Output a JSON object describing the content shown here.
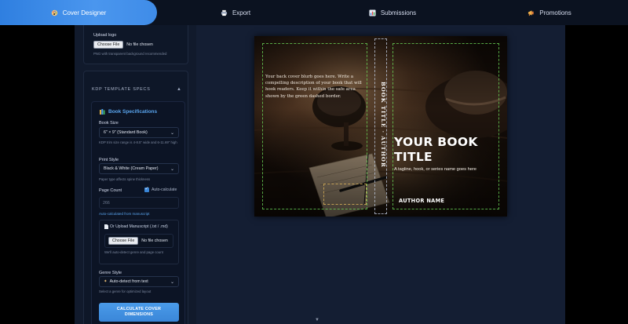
{
  "nav": {
    "tabs": [
      {
        "label": "Cover Designer",
        "icon": "palette-icon",
        "active": true
      },
      {
        "label": "Export",
        "icon": "printer-icon",
        "active": false
      },
      {
        "label": "Submissions",
        "icon": "chart-icon",
        "active": false
      },
      {
        "label": "Promotions",
        "icon": "megaphone-icon",
        "active": false
      }
    ]
  },
  "sidebar": {
    "logo": {
      "label": "Upload logo",
      "file_button": "Choose File",
      "file_status": "No file chosen",
      "hint": "PNG with transparent background recommended"
    },
    "kdp": {
      "section_title": "KDP TEMPLATE SPECS",
      "collapse_icon": "triangle-up-icon",
      "panel_title": "Book Specifications",
      "panel_icon": "books-icon",
      "book_size": {
        "label": "Book Size",
        "value": "6\" × 9\" (Standard Book)",
        "hint": "KDP trim size range is 4-8.5\" wide and 6-11.69\" high"
      },
      "print_style": {
        "label": "Print Style",
        "value": "Black & White (Cream Paper)",
        "hint": "Paper type affects spine thickness"
      },
      "page_count": {
        "label": "Page Count",
        "auto_label": "Auto-calculate",
        "auto_checked": true,
        "value": "266",
        "note": "Auto-calculated from manuscript"
      },
      "manuscript": {
        "label": "Or Upload Manuscript (.txt / .md)",
        "icon": "document-icon",
        "file_button": "Choose File",
        "file_status": "No file chosen",
        "hint": "We'll auto-detect genre and page count"
      },
      "genre": {
        "label": "Genre Style",
        "value": "Auto-detect from text",
        "icon": "sparkle-icon",
        "hint": "Select a genre for optimized layout"
      },
      "calc_button": "CALCULATE COVER DIMENSIONS"
    }
  },
  "cover": {
    "blurb": "Your back cover blurb goes here. Write a compelling description of your book that will hook readers. Keep it within the safe area shown by the green dashed border.",
    "spine_text": "BOOK TITLE · AUTHOR",
    "title": "YOUR BOOK TITLE",
    "tagline": "A tagline, hook, or series name goes here",
    "author": "AUTHOR NAME"
  },
  "colors": {
    "accent": "#3f8ce8",
    "nav_bg": "#0b1220",
    "sidebar_bg": "#111a2c",
    "preview_bg": "#141e33",
    "safe_area_guide": "#6edc5a"
  }
}
